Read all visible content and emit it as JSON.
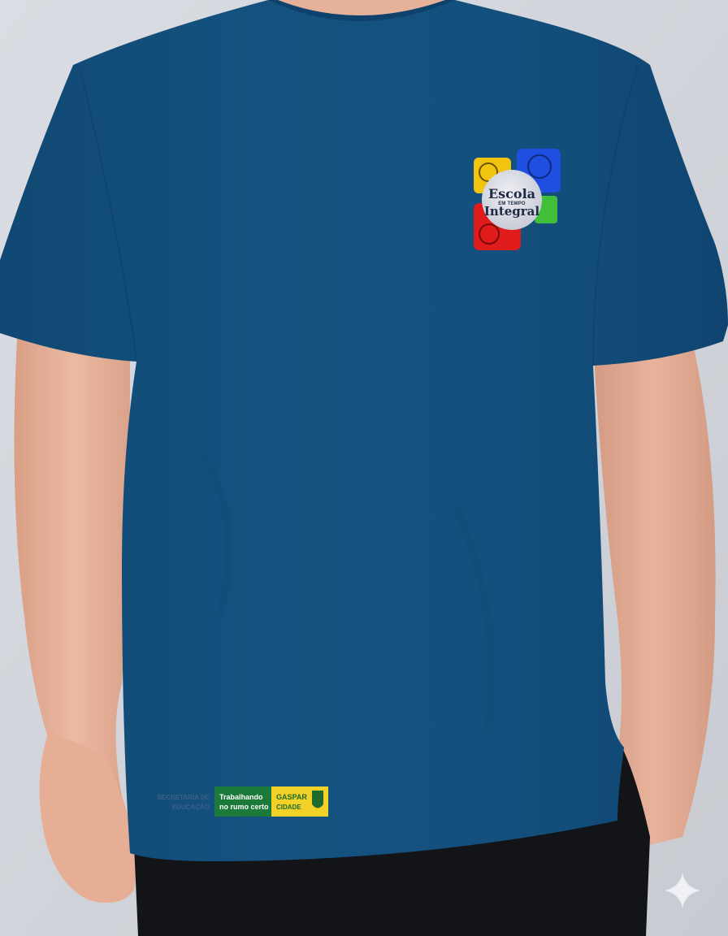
{
  "photo": {
    "subject": "blue-tshirt-mockup",
    "colors": {
      "background": "#d2d5db",
      "shirt": "#14507f",
      "shirt_shadow": "#0f4470",
      "skin": "#e9b39c",
      "pants": "#101217"
    }
  },
  "chest_logo": {
    "line1": "Escola",
    "line2": "EM TEMPO",
    "line3": "Integral",
    "tile_colors": {
      "yellow": "#f1c40f",
      "blue": "#1f4fe0",
      "green": "#3fbf3a",
      "red": "#e01b1b"
    }
  },
  "sponsor_strip": {
    "secretaria_line1": "SECRETARIA DE",
    "secretaria_line2": "EDUCAÇÃO",
    "green_line1": "Trabalhando",
    "green_line2": "no rumo certo",
    "yellow_line1": "GASPAR",
    "yellow_line2": "CIDADE",
    "colors": {
      "green": "#1b7a3a",
      "yellow": "#f2d229"
    }
  }
}
